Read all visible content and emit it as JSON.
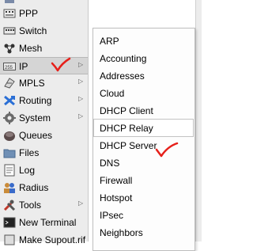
{
  "colors": {
    "annotation": "#e6201a",
    "sidebar_bg": "#ececec",
    "menu_bg": "#fdfdfd"
  },
  "sidebar": {
    "items": [
      {
        "label": "",
        "icon": "tool-icon",
        "has_submenu": false
      },
      {
        "label": "PPP",
        "icon": "ppp-icon",
        "has_submenu": false
      },
      {
        "label": "Switch",
        "icon": "switch-icon",
        "has_submenu": false
      },
      {
        "label": "Mesh",
        "icon": "mesh-icon",
        "has_submenu": false
      },
      {
        "label": "IP",
        "icon": "ip-icon",
        "has_submenu": true
      },
      {
        "label": "MPLS",
        "icon": "mpls-icon",
        "has_submenu": true
      },
      {
        "label": "Routing",
        "icon": "routing-icon",
        "has_submenu": true
      },
      {
        "label": "System",
        "icon": "system-gear-icon",
        "has_submenu": true
      },
      {
        "label": "Queues",
        "icon": "queues-icon",
        "has_submenu": false
      },
      {
        "label": "Files",
        "icon": "files-folder-icon",
        "has_submenu": false
      },
      {
        "label": "Log",
        "icon": "log-icon",
        "has_submenu": false
      },
      {
        "label": "Radius",
        "icon": "radius-users-icon",
        "has_submenu": false
      },
      {
        "label": "Tools",
        "icon": "tools-icon",
        "has_submenu": true
      },
      {
        "label": "New Terminal",
        "icon": "terminal-icon",
        "has_submenu": false
      },
      {
        "label": "Make Supout.rif",
        "icon": "supout-icon",
        "has_submenu": false
      }
    ]
  },
  "submenu": {
    "items": [
      {
        "label": "ARP"
      },
      {
        "label": "Accounting"
      },
      {
        "label": "Addresses"
      },
      {
        "label": "Cloud"
      },
      {
        "label": "DHCP Client"
      },
      {
        "label": "DHCP Relay"
      },
      {
        "label": "DHCP Server"
      },
      {
        "label": "DNS"
      },
      {
        "label": "Firewall"
      },
      {
        "label": "Hotspot"
      },
      {
        "label": "IPsec"
      },
      {
        "label": "Neighbors"
      }
    ]
  }
}
